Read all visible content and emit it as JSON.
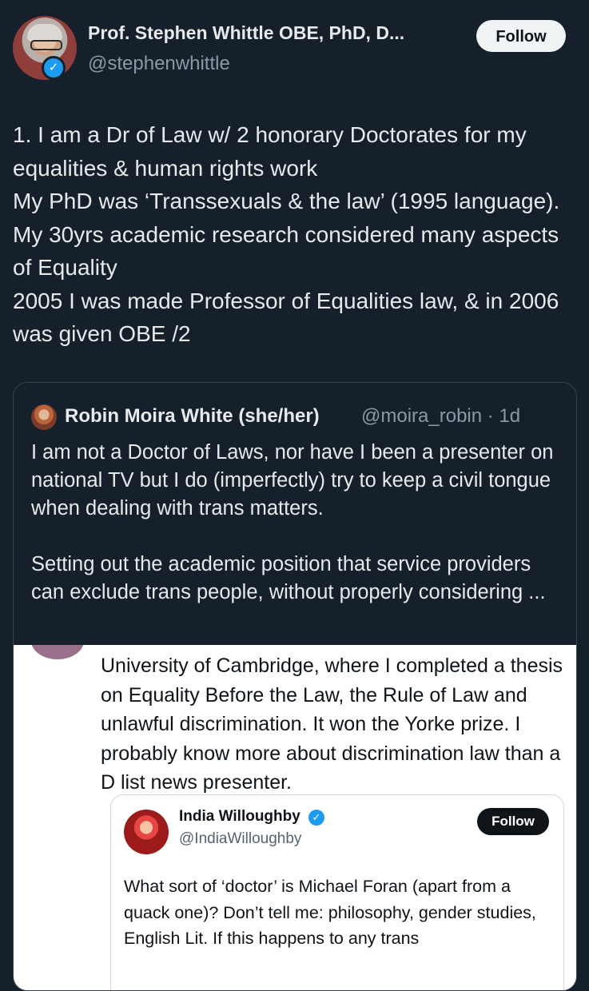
{
  "author": {
    "name": "Prof. Stephen Whittle OBE, PhD, D...",
    "handle": "@stephenwhittle",
    "verified_icon": "verified-badge-icon"
  },
  "follow_label": "Follow",
  "tweet_text": "1. I am a Dr of Law w/ 2 honorary Doctorates for my equalities & human rights work\nMy PhD was ‘Transsexuals & the law’ (1995 language). My 30yrs academic research considered many aspects of Equality\n2005 I was made Professor of Equalities law, & in 2006 was given OBE /2",
  "quote": {
    "name": "Robin Moira White (she/her)",
    "handle": "@moira_robin · 1d",
    "text": "I am not a Doctor of Laws, nor have I been a presenter on national TV but I do (imperfectly) try to keep a civil tongue when dealing with trans matters.\n\nSetting out the academic position that service providers can exclude trans people, without properly considering ...",
    "embedded_text": "University of Cambridge, where I completed a thesis on Equality Before the Law, the Rule of Law and unlawful discrimination. It won the Yorke prize. I probably know more about discrimination law than a D list news presenter.",
    "inner": {
      "name": "India Willoughby",
      "handle": "@IndiaWilloughby",
      "follow_label": "Follow",
      "text": "What sort of ‘doctor’ is Michael Foran (apart from a quack one)? Don’t tell me: philosophy, gender studies, English Lit. If this happens to any trans"
    }
  },
  "colors": {
    "background": "#15202b",
    "text": "#e7e9ea",
    "secondary": "#8b98a5",
    "accent": "#1d9bf0",
    "border": "#38444d"
  }
}
